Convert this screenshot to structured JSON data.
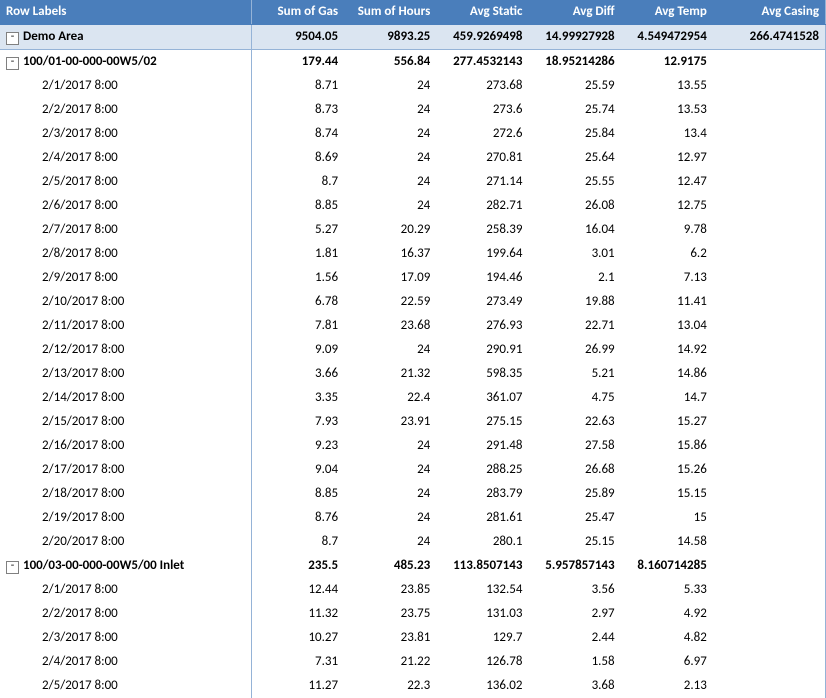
{
  "header": {
    "row_labels": "Row Labels",
    "cols": [
      "Sum of Gas",
      "Sum of Hours",
      "Avg Static",
      "Avg Diff",
      "Avg Temp",
      "Avg Casing"
    ]
  },
  "area": {
    "label": "Demo Area",
    "vals": [
      "9504.05",
      "9893.25",
      "459.9269498",
      "14.99927928",
      "4.549472954",
      "266.4741528"
    ]
  },
  "wells": [
    {
      "label": "100/01-00-000-00W5/02",
      "vals": [
        "179.44",
        "556.84",
        "277.4532143",
        "18.95214286",
        "12.9175",
        ""
      ],
      "rows": [
        {
          "label": "2/1/2017 8:00",
          "vals": [
            "8.71",
            "24",
            "273.68",
            "25.59",
            "13.55",
            ""
          ]
        },
        {
          "label": "2/2/2017 8:00",
          "vals": [
            "8.73",
            "24",
            "273.6",
            "25.74",
            "13.53",
            ""
          ]
        },
        {
          "label": "2/3/2017 8:00",
          "vals": [
            "8.74",
            "24",
            "272.6",
            "25.84",
            "13.4",
            ""
          ]
        },
        {
          "label": "2/4/2017 8:00",
          "vals": [
            "8.69",
            "24",
            "270.81",
            "25.64",
            "12.97",
            ""
          ]
        },
        {
          "label": "2/5/2017 8:00",
          "vals": [
            "8.7",
            "24",
            "271.14",
            "25.55",
            "12.47",
            ""
          ]
        },
        {
          "label": "2/6/2017 8:00",
          "vals": [
            "8.85",
            "24",
            "282.71",
            "26.08",
            "12.75",
            ""
          ]
        },
        {
          "label": "2/7/2017 8:00",
          "vals": [
            "5.27",
            "20.29",
            "258.39",
            "16.04",
            "9.78",
            ""
          ]
        },
        {
          "label": "2/8/2017 8:00",
          "vals": [
            "1.81",
            "16.37",
            "199.64",
            "3.01",
            "6.2",
            ""
          ]
        },
        {
          "label": "2/9/2017 8:00",
          "vals": [
            "1.56",
            "17.09",
            "194.46",
            "2.1",
            "7.13",
            ""
          ]
        },
        {
          "label": "2/10/2017 8:00",
          "vals": [
            "6.78",
            "22.59",
            "273.49",
            "19.88",
            "11.41",
            ""
          ]
        },
        {
          "label": "2/11/2017 8:00",
          "vals": [
            "7.81",
            "23.68",
            "276.93",
            "22.71",
            "13.04",
            ""
          ]
        },
        {
          "label": "2/12/2017 8:00",
          "vals": [
            "9.09",
            "24",
            "290.91",
            "26.99",
            "14.92",
            ""
          ]
        },
        {
          "label": "2/13/2017 8:00",
          "vals": [
            "3.66",
            "21.32",
            "598.35",
            "5.21",
            "14.86",
            ""
          ]
        },
        {
          "label": "2/14/2017 8:00",
          "vals": [
            "3.35",
            "22.4",
            "361.07",
            "4.75",
            "14.7",
            ""
          ]
        },
        {
          "label": "2/15/2017 8:00",
          "vals": [
            "7.93",
            "23.91",
            "275.15",
            "22.63",
            "15.27",
            ""
          ]
        },
        {
          "label": "2/16/2017 8:00",
          "vals": [
            "9.23",
            "24",
            "291.48",
            "27.58",
            "15.86",
            ""
          ]
        },
        {
          "label": "2/17/2017 8:00",
          "vals": [
            "9.04",
            "24",
            "288.25",
            "26.68",
            "15.26",
            ""
          ]
        },
        {
          "label": "2/18/2017 8:00",
          "vals": [
            "8.85",
            "24",
            "283.79",
            "25.89",
            "15.15",
            ""
          ]
        },
        {
          "label": "2/19/2017 8:00",
          "vals": [
            "8.76",
            "24",
            "281.61",
            "25.47",
            "15",
            ""
          ]
        },
        {
          "label": "2/20/2017 8:00",
          "vals": [
            "8.7",
            "24",
            "280.1",
            "25.15",
            "14.58",
            ""
          ]
        }
      ]
    },
    {
      "label": "100/03-00-000-00W5/00 Inlet",
      "vals": [
        "235.5",
        "485.23",
        "113.8507143",
        "5.957857143",
        "8.160714285",
        ""
      ],
      "rows": [
        {
          "label": "2/1/2017 8:00",
          "vals": [
            "12.44",
            "23.85",
            "132.54",
            "3.56",
            "5.33",
            ""
          ]
        },
        {
          "label": "2/2/2017 8:00",
          "vals": [
            "11.32",
            "23.75",
            "131.03",
            "2.97",
            "4.92",
            ""
          ]
        },
        {
          "label": "2/3/2017 8:00",
          "vals": [
            "10.27",
            "23.81",
            "129.7",
            "2.44",
            "4.82",
            ""
          ]
        },
        {
          "label": "2/4/2017 8:00",
          "vals": [
            "7.31",
            "21.22",
            "126.78",
            "1.58",
            "6.97",
            ""
          ]
        },
        {
          "label": "2/5/2017 8:00",
          "vals": [
            "11.27",
            "22.3",
            "136.02",
            "3.68",
            "2.13",
            ""
          ]
        }
      ]
    }
  ]
}
